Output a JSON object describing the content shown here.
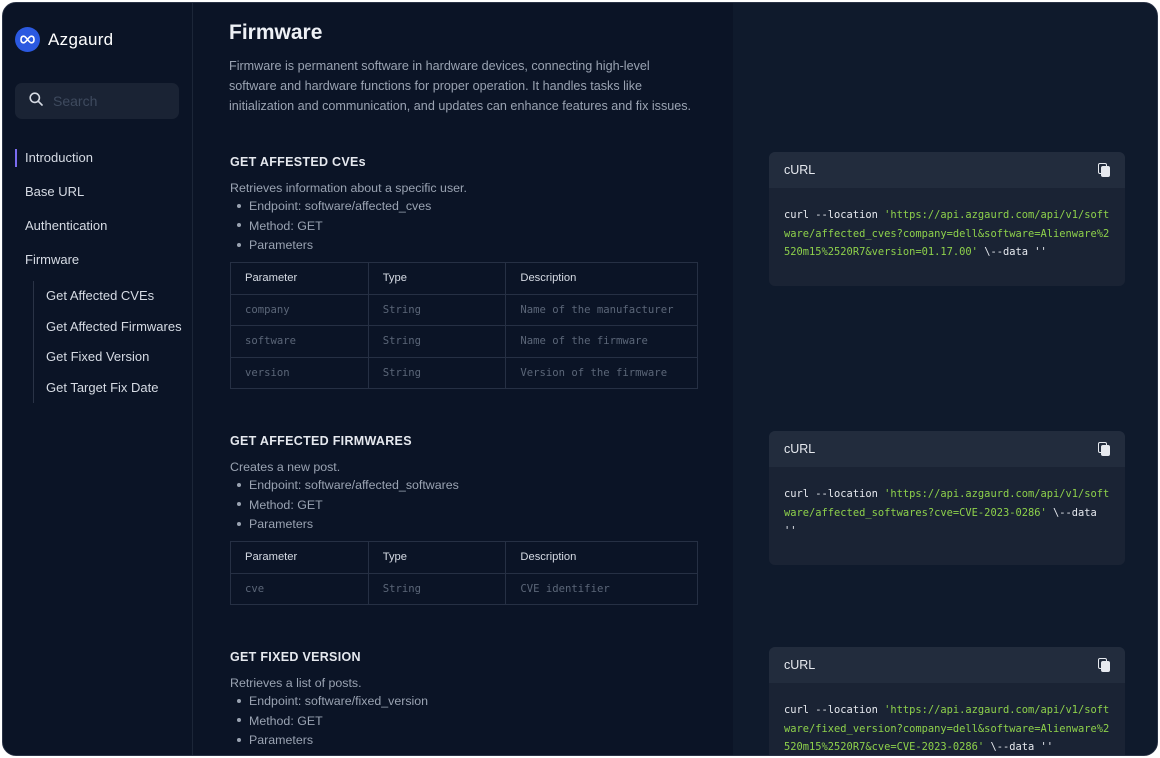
{
  "app": {
    "name": "Azgaurd"
  },
  "search": {
    "placeholder": "Search"
  },
  "nav": {
    "items": [
      "Introduction",
      "Base URL",
      "Authentication",
      "Firmware"
    ],
    "sub_items": [
      "Get Affected CVEs",
      "Get Affected Firmwares",
      "Get Fixed Version",
      "Get Target Fix Date"
    ]
  },
  "page": {
    "title": "Firmware",
    "intro": "Firmware is permanent software in hardware devices, connecting high-level software and hardware functions for proper operation. It handles tasks like initialization and communication, and updates can enhance features and fix issues."
  },
  "table_headers": [
    "Parameter",
    "Type",
    "Description"
  ],
  "sections": [
    {
      "title": "GET AFFESTED CVEs",
      "desc": "Retrieves information about a specific user.",
      "endpoint": "Endpoint: software/affected_cves",
      "method": "Method: GET",
      "params_label": "Parameters",
      "rows": [
        [
          "company",
          "String",
          "Name of the manufacturer"
        ],
        [
          "software",
          "String",
          "Name of the firmware"
        ],
        [
          "version",
          "String",
          "Version of the firmware"
        ]
      ]
    },
    {
      "title": "GET AFFECTED FIRMWARES",
      "desc": "Creates a new post.",
      "endpoint": "Endpoint: software/affected_softwares",
      "method": "Method: GET",
      "params_label": "Parameters",
      "rows": [
        [
          "cve",
          "String",
          "CVE identifier"
        ]
      ]
    },
    {
      "title": "GET FIXED VERSION",
      "desc": "Retrieves a list of posts.",
      "endpoint": "Endpoint: software/fixed_version",
      "method": "Method: GET",
      "params_label": "Parameters",
      "rows": []
    }
  ],
  "code_cards": [
    {
      "label": "cURL",
      "prefix": "curl --location ",
      "url": "'https://api.azgaurd.com/api/v1/software/affected_cves?company=dell&software=Alienware%2520m15%2520R7&version=01.17.00'",
      "suffix": " \\--data ''"
    },
    {
      "label": "cURL",
      "prefix": "curl --location ",
      "url": "'https://api.azgaurd.com/api/v1/software/affected_softwares?cve=CVE-2023-0286'",
      "suffix": " \\--data ''"
    },
    {
      "label": "cURL",
      "prefix": "curl --location ",
      "url": "'https://api.azgaurd.com/api/v1/software/fixed_version?company=dell&software=Alienware%2520m15%2520R7&cve=CVE-2023-0286'",
      "suffix": " \\--data ''"
    }
  ],
  "colors": {
    "background": "#0b1426",
    "panel": "#0f1a2c",
    "accent": "#7b6cf0",
    "code_string": "#8ed14b",
    "logo": "#2b59e0"
  }
}
